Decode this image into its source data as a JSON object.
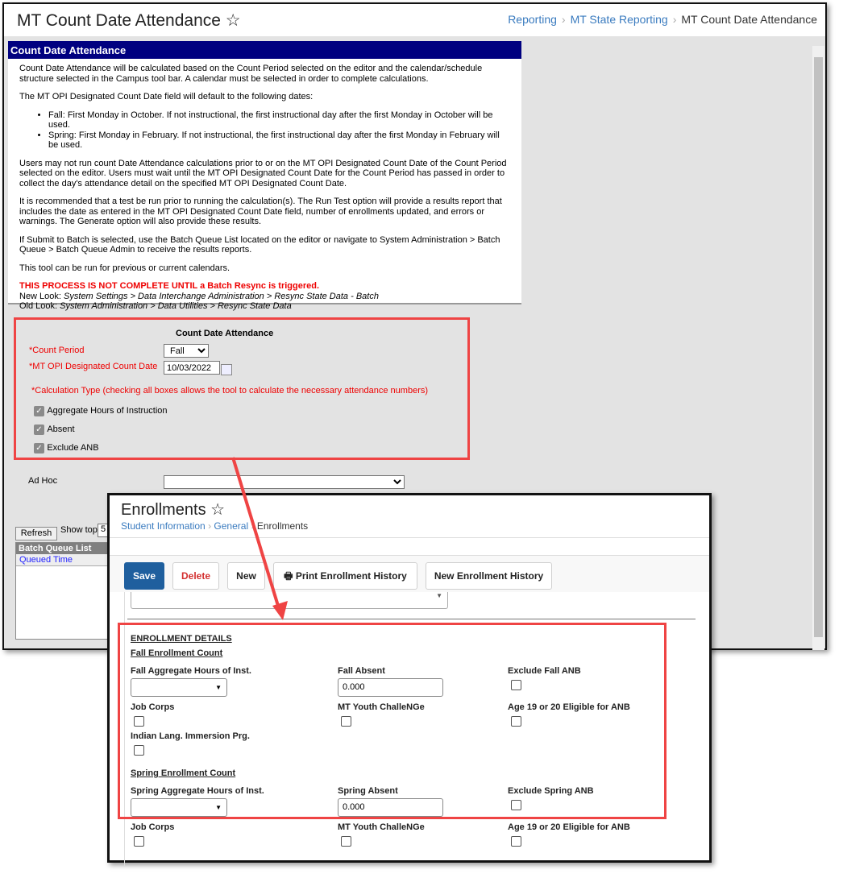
{
  "header": {
    "title": "MT Count Date Attendance",
    "breadcrumbs": [
      "Reporting",
      "MT State Reporting",
      "MT Count Date Attendance"
    ]
  },
  "info": {
    "heading": "Count Date Attendance",
    "p1": "Count Date Attendance will be calculated based on the Count Period selected on the editor and the calendar/schedule structure selected in the Campus tool bar. A calendar must be selected in order to complete calculations.",
    "p2": "The MT OPI Designated Count Date field will default to the following dates:",
    "bullets": [
      "Fall: First Monday in October. If not instructional, the first instructional day after the first Monday in October will be used.",
      "Spring: First Monday in February. If not instructional, the first instructional day after the first Monday in February will be used."
    ],
    "p3": "Users may not run count Date Attendance calculations prior to or on the MT OPI Designated Count Date of the Count Period selected on the editor. Users must wait until the MT OPI Designated Count Date for the Count Period has passed in order to collect the day's attendance detail on the specified MT OPI Designated Count Date.",
    "p4": "It is recommended that a test be run prior to running the calculation(s). The Run Test option will provide a results report that includes the date as entered in the MT OPI Designated Count Date field, number of enrollments updated, and errors or warnings. The Generate option will also provide these results.",
    "p5": "If Submit to Batch is selected, use the Batch Queue List located on the editor or navigate to System Administration > Batch Queue > Batch Queue Admin to receive the results reports.",
    "p6": "This tool can be run for previous or current calendars.",
    "warning": "THIS PROCESS IS NOT COMPLETE UNTIL a Batch Resync is triggered.",
    "new_look_label": "New Look:",
    "new_look_path": "System Settings > Data Interchange Administration > Resync State Data - Batch",
    "old_look_label": "Old Look:",
    "old_look_path": "System Administration > Data Utilities > Resync State Data"
  },
  "form": {
    "title": "Count Date Attendance",
    "count_period_label": "*Count Period",
    "count_period_value": "Fall",
    "count_date_label": "*MT OPI Designated Count Date",
    "count_date_value": "10/03/2022",
    "calc_type_label": "*Calculation Type (checking all boxes allows the tool to calculate the necessary attendance numbers)",
    "checkboxes": [
      {
        "label": "Aggregate Hours of Instruction",
        "checked": true
      },
      {
        "label": "Absent",
        "checked": true
      },
      {
        "label": "Exclude ANB",
        "checked": true
      }
    ],
    "ad_hoc_label": "Ad Hoc",
    "ad_hoc_value": ""
  },
  "batch": {
    "refresh": "Refresh",
    "show_top": "Show top",
    "show_top_value": "5",
    "list_title": "Batch Queue List",
    "queued_time": "Queued Time"
  },
  "enrollments": {
    "title": "Enrollments",
    "breadcrumbs": [
      "Student Information",
      "General",
      "Enrollments"
    ],
    "buttons": {
      "save": "Save",
      "delete": "Delete",
      "new": "New",
      "print": "Print Enrollment History",
      "new_history": "New Enrollment History"
    },
    "section": "ENROLLMENT DETAILS",
    "fall_heading": "Fall Enrollment Count",
    "spring_heading": "Spring Enrollment Count",
    "fall": {
      "agg": "Fall Aggregate Hours of Inst.",
      "absent": "Fall Absent",
      "absent_value": "0.000",
      "exclude": "Exclude Fall ANB"
    },
    "row2": {
      "job": "Job Corps",
      "youth": "MT Youth ChalleNGe",
      "age": "Age 19 or 20 Eligible for ANB"
    },
    "indian": "Indian Lang. Immersion Prg.",
    "spring": {
      "agg": "Spring Aggregate Hours of Inst.",
      "absent": "Spring Absent",
      "absent_value": "0.000",
      "exclude": "Exclude Spring ANB"
    },
    "row3": {
      "job": "Job Corps",
      "youth": "MT Youth ChalleNGe",
      "age": "Age 19 or 20 Eligible for ANB"
    }
  },
  "colors": {
    "highlight": "#ef4444",
    "header_bar": "#000080",
    "save": "#1f5f9e",
    "link": "#3a7bbf"
  }
}
